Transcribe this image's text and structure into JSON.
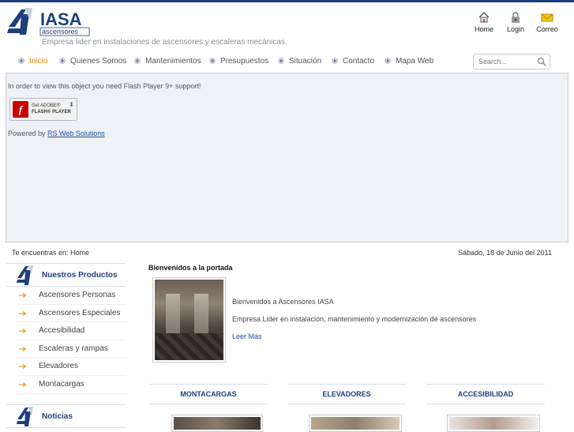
{
  "header": {
    "logo_text": "IASA",
    "logo_subtext": "ascensores",
    "slogan": "Empresa lider en instalaciones de ascensores y escaleras mecánicas.",
    "top_links": [
      {
        "label": "Home",
        "icon": "home-icon"
      },
      {
        "label": "Login",
        "icon": "lock-icon"
      },
      {
        "label": "Correo",
        "icon": "envelope-icon"
      }
    ]
  },
  "nav": {
    "items": [
      {
        "label": "Inicio",
        "active": true
      },
      {
        "label": "Quienes Somos"
      },
      {
        "label": "Mantenimientos"
      },
      {
        "label": "Presupuestos"
      },
      {
        "label": "Situación"
      },
      {
        "label": "Contacto"
      },
      {
        "label": "Mapa Web"
      }
    ],
    "search_placeholder": "Search..."
  },
  "flash": {
    "message": "In order to view this object you need Flash Player 9+ support!",
    "button_line1": "Get ADOBE®",
    "button_line2": "FLASH® PLAYER",
    "powered_prefix": "Powered by",
    "powered_link": "RS Web Solutions"
  },
  "breadcrumb": "Te encuentras en: Home",
  "date": "Sábado, 18 de Junio del 2011",
  "sidebar": {
    "products_title": "Nuestros Productos",
    "products": [
      "Ascensores Personas",
      "Ascensores Especiales",
      "Accesibilidad",
      "Escaleras y rampas",
      "Elevadores",
      "Montacargas"
    ],
    "news_title": "Noticias"
  },
  "main": {
    "welcome_heading": "Bienvenidos a la portada",
    "welcome_line1": "Bienvenidos a Ascensores IASA",
    "welcome_line2": "Empresa Lider en instalación, mantenimiento y modernización de ascensores",
    "read_more": "Leer Más",
    "categories": [
      "MONTACARGAS",
      "ELEVADORES",
      "ACCESIBILIDAD"
    ]
  },
  "colors": {
    "brand_blue": "#1d3f7e",
    "active_orange": "#e08a00",
    "arrow_orange": "#f0a020"
  }
}
